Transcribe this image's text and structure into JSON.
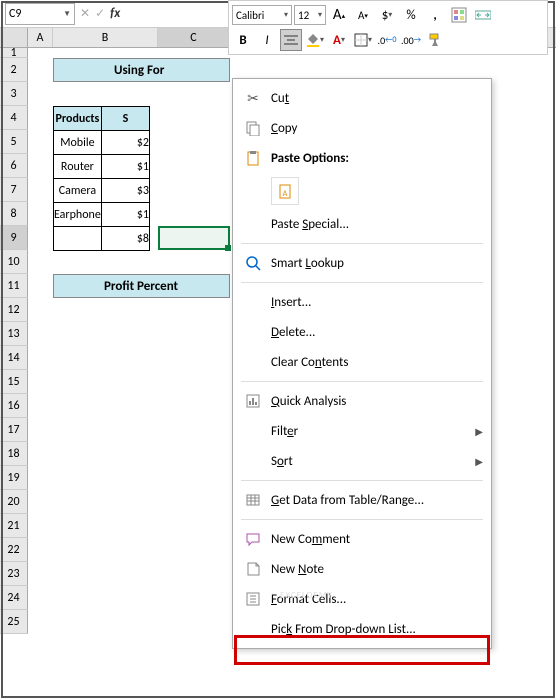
{
  "namebox": {
    "cell_ref": "C9"
  },
  "mini_toolbar": {
    "font_name": "Calibri",
    "font_size": "12",
    "btn_inc_font": "A",
    "btn_dec_font": "A",
    "btn_currency": "$",
    "btn_percent": "%",
    "btn_comma": ",",
    "btn_bold": "B",
    "btn_italic": "I"
  },
  "col_headers": {
    "a": "A",
    "b": "B",
    "c": "C"
  },
  "row_headers": [
    "1",
    "2",
    "3",
    "4",
    "5",
    "6",
    "7",
    "8",
    "9",
    "10",
    "11",
    "12",
    "13",
    "14",
    "15",
    "16",
    "17",
    "18",
    "19",
    "20",
    "21",
    "22",
    "23",
    "24",
    "25"
  ],
  "sheet": {
    "title": "Using For",
    "table_header": {
      "products": "Products",
      "sales": "S"
    },
    "rows": [
      {
        "product": "Mobile",
        "sale": "$2"
      },
      {
        "product": "Router",
        "sale": "$1"
      },
      {
        "product": "Camera",
        "sale": "$3"
      },
      {
        "product": "Earphone",
        "sale": "$1"
      }
    ],
    "total_sale": "$8",
    "profit_label": "Profit Percent"
  },
  "context_menu": {
    "cut": "Cut",
    "copy": "Copy",
    "paste_options": "Paste Options:",
    "paste_special": "Paste Special...",
    "smart_lookup": "Smart Lookup",
    "insert": "Insert...",
    "delete": "Delete...",
    "clear_contents": "Clear Contents",
    "quick_analysis": "Quick Analysis",
    "filter": "Filter",
    "sort": "Sort",
    "get_data": "Get Data from Table/Range...",
    "new_comment": "New Comment",
    "new_note": "New Note",
    "format_cells": "Format Cells...",
    "pick_list": "Pick From Drop-down List..."
  },
  "watermark": "EXCELDEMY"
}
